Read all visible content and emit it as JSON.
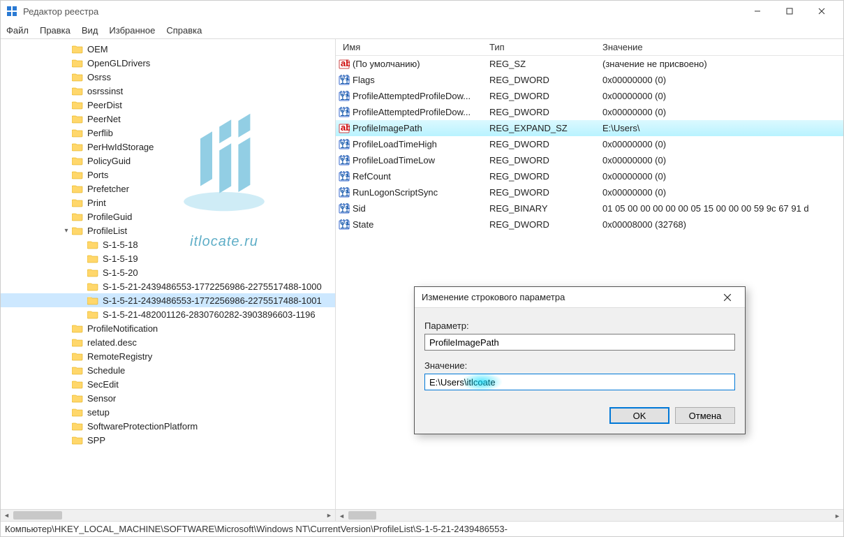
{
  "window": {
    "title": "Редактор реестра"
  },
  "menu": [
    "Файл",
    "Правка",
    "Вид",
    "Избранное",
    "Справка"
  ],
  "watermark": "itlocate.ru",
  "tree": [
    {
      "depth": 3,
      "twisty": "",
      "label": "OEM"
    },
    {
      "depth": 3,
      "twisty": "",
      "label": "OpenGLDrivers"
    },
    {
      "depth": 3,
      "twisty": "",
      "label": "Osrss"
    },
    {
      "depth": 3,
      "twisty": "",
      "label": "osrssinst"
    },
    {
      "depth": 3,
      "twisty": "",
      "label": "PeerDist"
    },
    {
      "depth": 3,
      "twisty": "",
      "label": "PeerNet"
    },
    {
      "depth": 3,
      "twisty": "",
      "label": "Perflib"
    },
    {
      "depth": 3,
      "twisty": "",
      "label": "PerHwIdStorage"
    },
    {
      "depth": 3,
      "twisty": "",
      "label": "PolicyGuid"
    },
    {
      "depth": 3,
      "twisty": "",
      "label": "Ports"
    },
    {
      "depth": 3,
      "twisty": "",
      "label": "Prefetcher"
    },
    {
      "depth": 3,
      "twisty": "",
      "label": "Print"
    },
    {
      "depth": 3,
      "twisty": "",
      "label": "ProfileGuid"
    },
    {
      "depth": 3,
      "twisty": "v",
      "label": "ProfileList"
    },
    {
      "depth": 4,
      "twisty": "",
      "label": "S-1-5-18"
    },
    {
      "depth": 4,
      "twisty": "",
      "label": "S-1-5-19"
    },
    {
      "depth": 4,
      "twisty": "",
      "label": "S-1-5-20"
    },
    {
      "depth": 4,
      "twisty": "",
      "label": "S-1-5-21-2439486553-1772256986-2275517488-1000"
    },
    {
      "depth": 4,
      "twisty": "",
      "label": "S-1-5-21-2439486553-1772256986-2275517488-1001",
      "selected": true
    },
    {
      "depth": 4,
      "twisty": "",
      "label": "S-1-5-21-482001126-2830760282-3903896603-1196"
    },
    {
      "depth": 3,
      "twisty": "",
      "label": "ProfileNotification"
    },
    {
      "depth": 3,
      "twisty": "",
      "label": "related.desc"
    },
    {
      "depth": 3,
      "twisty": "",
      "label": "RemoteRegistry"
    },
    {
      "depth": 3,
      "twisty": "",
      "label": "Schedule"
    },
    {
      "depth": 3,
      "twisty": "",
      "label": "SecEdit"
    },
    {
      "depth": 3,
      "twisty": "",
      "label": "Sensor"
    },
    {
      "depth": 3,
      "twisty": "",
      "label": "setup"
    },
    {
      "depth": 3,
      "twisty": "",
      "label": "SoftwareProtectionPlatform"
    },
    {
      "depth": 3,
      "twisty": "",
      "label": "SPP"
    }
  ],
  "list": {
    "headers": {
      "name": "Имя",
      "type": "Тип",
      "value": "Значение"
    },
    "rows": [
      {
        "icon": "sz",
        "name": "(По умолчанию)",
        "type": "REG_SZ",
        "value": "(значение не присвоено)"
      },
      {
        "icon": "bin",
        "name": "Flags",
        "type": "REG_DWORD",
        "value": "0x00000000 (0)"
      },
      {
        "icon": "bin",
        "name": "ProfileAttemptedProfileDow...",
        "type": "REG_DWORD",
        "value": "0x00000000 (0)"
      },
      {
        "icon": "bin",
        "name": "ProfileAttemptedProfileDow...",
        "type": "REG_DWORD",
        "value": "0x00000000 (0)"
      },
      {
        "icon": "sz",
        "name": "ProfileImagePath",
        "type": "REG_EXPAND_SZ",
        "value": "E:\\Users\\",
        "hl": true
      },
      {
        "icon": "bin",
        "name": "ProfileLoadTimeHigh",
        "type": "REG_DWORD",
        "value": "0x00000000 (0)"
      },
      {
        "icon": "bin",
        "name": "ProfileLoadTimeLow",
        "type": "REG_DWORD",
        "value": "0x00000000 (0)"
      },
      {
        "icon": "bin",
        "name": "RefCount",
        "type": "REG_DWORD",
        "value": "0x00000000 (0)"
      },
      {
        "icon": "bin",
        "name": "RunLogonScriptSync",
        "type": "REG_DWORD",
        "value": "0x00000000 (0)"
      },
      {
        "icon": "bin",
        "name": "Sid",
        "type": "REG_BINARY",
        "value": "01 05 00 00 00 00 00 05 15 00 00 00 59 9c 67 91 d"
      },
      {
        "icon": "bin",
        "name": "State",
        "type": "REG_DWORD",
        "value": "0x00008000 (32768)"
      }
    ]
  },
  "dialog": {
    "title": "Изменение строкового параметра",
    "param_label": "Параметр:",
    "param_value": "ProfileImagePath",
    "value_label": "Значение:",
    "value_value": "E:\\Users\\itlcoate",
    "ok": "OK",
    "cancel": "Отмена"
  },
  "statusbar": "Компьютер\\HKEY_LOCAL_MACHINE\\SOFTWARE\\Microsoft\\Windows NT\\CurrentVersion\\ProfileList\\S-1-5-21-2439486553-"
}
